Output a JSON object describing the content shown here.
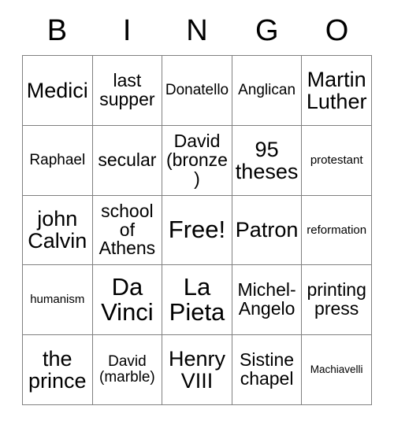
{
  "card": {
    "title": "BINGO",
    "header_letters": [
      "B",
      "I",
      "N",
      "G",
      "O"
    ],
    "accent_color": "#000000",
    "border_color": "#808080",
    "background_color": "#ffffff",
    "free_space_label": "Free!",
    "rows": [
      [
        {
          "label": "Medici",
          "size": "fs-lg",
          "free": false
        },
        {
          "label": "last supper",
          "size": "fs-md",
          "free": false
        },
        {
          "label": "Donatello",
          "size": "fs-sm",
          "free": false
        },
        {
          "label": "Anglican",
          "size": "fs-sm",
          "free": false
        },
        {
          "label": "Martin Luther",
          "size": "fs-lg",
          "free": false
        }
      ],
      [
        {
          "label": "Raphael",
          "size": "fs-sm",
          "free": false
        },
        {
          "label": "secular",
          "size": "fs-md",
          "free": false
        },
        {
          "label": "David (bronze)",
          "size": "fs-md",
          "free": false
        },
        {
          "label": "95 theses",
          "size": "fs-lg",
          "free": false
        },
        {
          "label": "protestant",
          "size": "fs-xs",
          "free": false
        }
      ],
      [
        {
          "label": "john Calvin",
          "size": "fs-lg",
          "free": false
        },
        {
          "label": "school of Athens",
          "size": "fs-md",
          "free": false
        },
        {
          "label": "Free!",
          "size": "fs-xl",
          "free": true
        },
        {
          "label": "Patron",
          "size": "fs-lg",
          "free": false
        },
        {
          "label": "reformation",
          "size": "fs-xs",
          "free": false
        }
      ],
      [
        {
          "label": "humanism",
          "size": "fs-xs",
          "free": false
        },
        {
          "label": "Da Vinci",
          "size": "fs-xl",
          "free": false
        },
        {
          "label": "La Pieta",
          "size": "fs-xl",
          "free": false
        },
        {
          "label": "Michel-Angelo",
          "size": "fs-md",
          "free": false
        },
        {
          "label": "printing press",
          "size": "fs-md",
          "free": false
        }
      ],
      [
        {
          "label": "the prince",
          "size": "fs-lg",
          "free": false
        },
        {
          "label": "David (marble)",
          "size": "fs-sm",
          "free": false
        },
        {
          "label": "Henry VIII",
          "size": "fs-lg",
          "free": false
        },
        {
          "label": "Sistine chapel",
          "size": "fs-md",
          "free": false
        },
        {
          "label": "Machiavelli",
          "size": "fs-xxs",
          "free": false
        }
      ]
    ]
  }
}
